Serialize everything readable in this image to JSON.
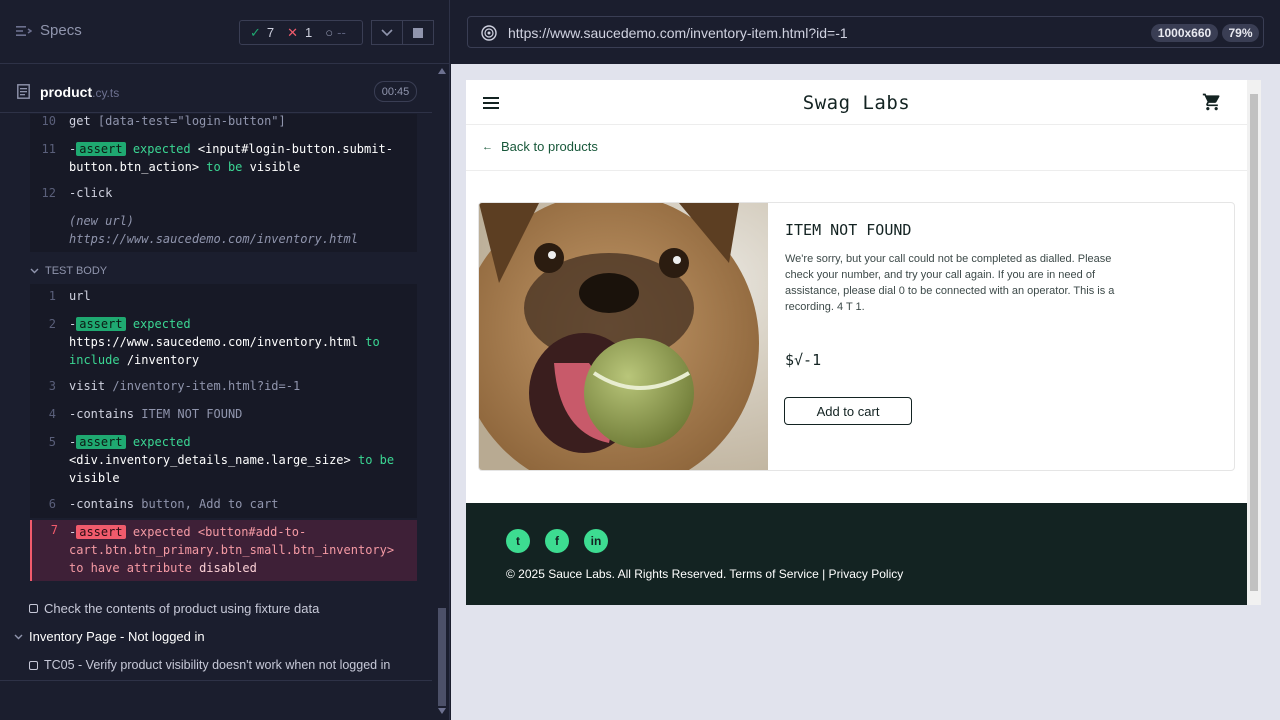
{
  "runner": {
    "specs_label": "Specs",
    "stats": {
      "passed": "7",
      "failed": "1",
      "pending": "--"
    },
    "spec_file": {
      "name": "product",
      "ext": ".cy.ts",
      "duration": "00:45"
    },
    "before_each": [
      {
        "num": "10",
        "html": "get <span class='gry'>[data-test=\"login-button\"]</span>"
      },
      {
        "num": "11",
        "html": "-<span class='badge'>assert</span> <span class='grn'>expected</span> <span class='wht'>&lt;input#login-button.submit-button.btn_action&gt;</span> <span class='grn'>to be</span> <span class='wht'>visible</span>"
      },
      {
        "num": "12",
        "html": "-click"
      },
      {
        "num": "",
        "html": "<span class='ital'>(new url)</span> <span class='ital'>https://www.saucedemo.com/inventory.html</span>"
      }
    ],
    "test_body_label": "TEST BODY",
    "test_body": [
      {
        "num": "1",
        "html": "url"
      },
      {
        "num": "2",
        "html": "-<span class='badge'>assert</span> <span class='grn'>expected</span> <span class='wht'>https://www.saucedemo.com/inventory.html</span> <span class='grn'>to include</span> <span class='wht'>/inventory</span>"
      },
      {
        "num": "3",
        "html": "visit <span class='gry'>/inventory-item.html?id=-1</span>"
      },
      {
        "num": "4",
        "html": "-contains <span class='gry'>ITEM NOT FOUND</span>"
      },
      {
        "num": "5",
        "html": "-<span class='badge'>assert</span> <span class='grn'>expected</span> <span class='wht'>&lt;div.inventory_details_name.large_size&gt;</span> <span class='grn'>to be</span> <span class='wht'>visible</span>"
      },
      {
        "num": "6",
        "html": "-contains <span class='gry'>button, Add to cart</span>"
      }
    ],
    "failed_cmd": {
      "num": "7",
      "html": "-<span class='badge'>assert</span> <span class='red'>expected</span> <span class='red'>&lt;button#add-to-cart.btn.btn_primary.btn_small.btn_inventory&gt;</span> <span class='red'>to have attribute</span> <span style='color:#fbd0d5'>disabled</span>"
    },
    "tests": [
      {
        "label": "Check the contents of product using fixture data"
      },
      {
        "label": "Inventory Page - Not logged in"
      },
      {
        "label": "TC05 - Verify product visibility doesn't work when not logged in"
      }
    ]
  },
  "browser": {
    "url": "https://www.saucedemo.com/inventory-item.html?id=-1",
    "viewport": "1000x660",
    "zoom": "79%"
  },
  "app": {
    "logo": "Swag Labs",
    "back_label": "Back to products",
    "item_name": "ITEM NOT FOUND",
    "item_desc": "We're sorry, but your call could not be completed as dialled. Please check your number, and try your call again. If you are in need of assistance, please dial 0 to be connected with an operator. This is a recording. 4 T 1.",
    "price": "$√-1",
    "add_btn": "Add to cart",
    "footer_copy": "© 2025 Sauce Labs. All Rights Reserved. Terms of Service | Privacy Policy",
    "social": [
      "twitter-icon",
      "facebook-icon",
      "linkedin-icon"
    ]
  }
}
